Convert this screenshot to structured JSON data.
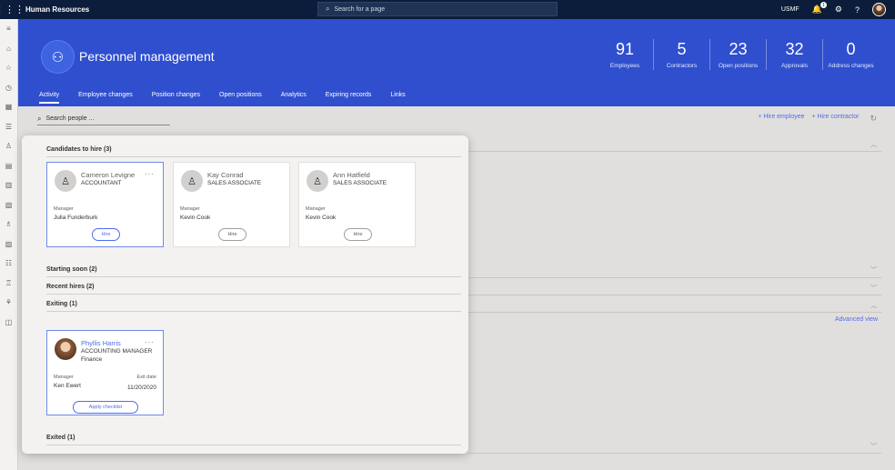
{
  "topbar": {
    "app_title": "Human Resources",
    "search_placeholder": "Search for a page",
    "company": "USMF",
    "notification_count": "1"
  },
  "header": {
    "title": "Personnel management",
    "stats": [
      {
        "value": "91",
        "label": "Employees"
      },
      {
        "value": "5",
        "label": "Contractors"
      },
      {
        "value": "23",
        "label": "Open positions"
      },
      {
        "value": "32",
        "label": "Approvals"
      },
      {
        "value": "0",
        "label": "Address changes"
      }
    ],
    "tabs": [
      "Activity",
      "Employee changes",
      "Position changes",
      "Open positions",
      "Analytics",
      "Expiring records",
      "Links"
    ]
  },
  "toolbar": {
    "search_people": "Search people ...",
    "hire_employee": "+ Hire employee",
    "hire_contractor": "+ Hire contractor"
  },
  "sections": {
    "candidates": "Candidates to hire (3)",
    "starting_soon": "Starting soon (2)",
    "recent_hires": "Recent hires (2)",
    "exiting": "Exiting (1)",
    "exited": "Exited (1)",
    "advanced_view": "Advanced view"
  },
  "candidates": [
    {
      "name": "Cameron Levigne",
      "role": "ACCOUNTANT",
      "manager_label": "Manager",
      "manager": "Julia Funderburk",
      "action": "Hire"
    },
    {
      "name": "Kay Conrad",
      "role": "SALES ASSOCIATE",
      "manager_label": "Manager",
      "manager": "Kevin Cook",
      "action": "Hire"
    },
    {
      "name": "Ann Hatfield",
      "role": "SALES ASSOCIATE",
      "manager_label": "Manager",
      "manager": "Kevin Cook",
      "action": "Hire"
    }
  ],
  "exiting": [
    {
      "name": "Phyllis Harris",
      "role": "ACCOUNTING MANAGER",
      "department": "Finance",
      "manager_label": "Manager",
      "manager": "Ken Ewert",
      "exit_label": "Exit date",
      "exit_date": "11/20/2020",
      "action": "Apply checklist"
    }
  ]
}
